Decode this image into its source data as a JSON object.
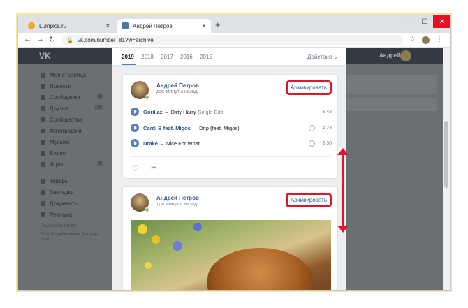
{
  "browser": {
    "tabs": [
      {
        "title": "Lumpics.ru",
        "fav_color": "#f5a623"
      },
      {
        "title": "Андрей Петров",
        "fav_color": "#4a76a8"
      }
    ],
    "new_tab": "+",
    "url": "vk.com/number_81?w=archive",
    "controls": {
      "minimize": "–",
      "maximize": "☐",
      "close": "✕"
    }
  },
  "vk": {
    "logo": "VK",
    "user_name": "Андрей",
    "sidebar": [
      {
        "label": "Моя страница"
      },
      {
        "label": "Новости"
      },
      {
        "label": "Сообщения",
        "count": "1"
      },
      {
        "label": "Друзья",
        "count": "18"
      },
      {
        "label": "Сообщества"
      },
      {
        "label": "Фотографии"
      },
      {
        "label": "Музыка"
      },
      {
        "label": "Видео"
      },
      {
        "label": "Игры",
        "count": "6"
      }
    ],
    "sidebar2": [
      {
        "label": "Товары"
      },
      {
        "label": "Закладки"
      },
      {
        "label": "Документы"
      },
      {
        "label": "Реклама"
      }
    ],
    "powered": "Powered by NGINX",
    "footer_links": "Блог   Разработчикам   Реклама   Ещё ⌄"
  },
  "archive": {
    "years": [
      "2019",
      "2018",
      "2017",
      "2016",
      "2015"
    ],
    "actions": "Действия ⌄",
    "posts": [
      {
        "author": "Андрей Петров",
        "time": "две минуты назад",
        "archive_label": "Архивировать",
        "tracks": [
          {
            "artist": "Gorillaz",
            "title": "Dirty Harry",
            "subtitle": "Single Edit",
            "duration": "3:43"
          },
          {
            "artist": "Cardi B feat. Migos",
            "title": "Drip (feat. Migos)",
            "subtitle": "",
            "duration": "4:23"
          },
          {
            "artist": "Drake",
            "title": "Nice For What",
            "subtitle": "",
            "duration": "3:30"
          }
        ]
      },
      {
        "author": "Андрей Петров",
        "time": "три минуты назад",
        "archive_label": "Архивировать"
      }
    ]
  },
  "colors": {
    "accent": "#5181b8",
    "highlight": "#e0152c",
    "link": "#2a5885"
  }
}
